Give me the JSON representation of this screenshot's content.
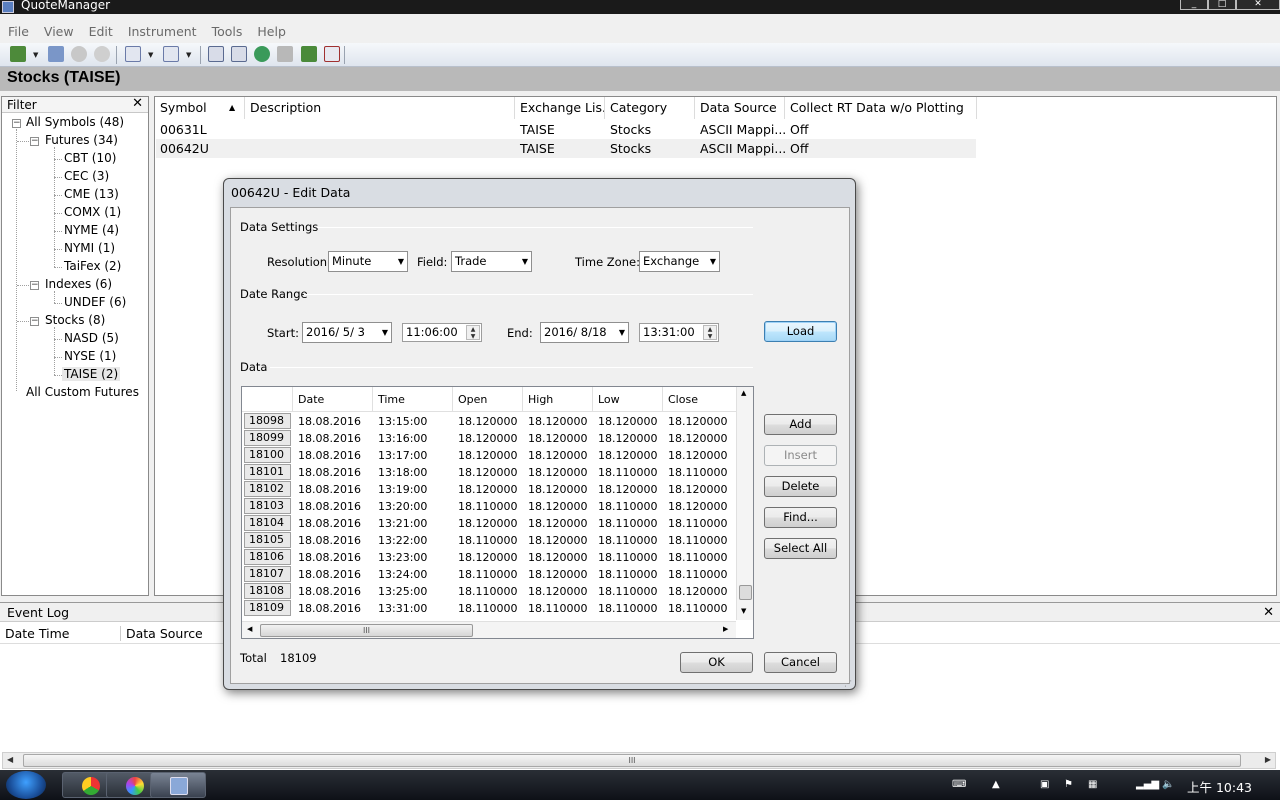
{
  "app": {
    "title": "QuoteManager"
  },
  "menu": [
    "File",
    "View",
    "Edit",
    "Instrument",
    "Tools",
    "Help"
  ],
  "toolbar_icons": [
    "add-instrument-icon",
    "add-symbol-icon",
    "settings-icon",
    "disconnect-icon",
    "import-icon",
    "export-icon",
    "view-list-icon",
    "view-detail-icon",
    "chart-icon",
    "exchange-icon",
    "notebook-icon",
    "calendar-icon"
  ],
  "window_header": "Stocks (TAISE)",
  "filter": {
    "title": "Filter",
    "close": "✕",
    "tree": [
      {
        "label": "All Symbols (48)",
        "level": 0,
        "box": "−"
      },
      {
        "label": "Futures (34)",
        "level": 1,
        "box": "−"
      },
      {
        "label": "CBT (10)",
        "level": 2
      },
      {
        "label": "CEC (3)",
        "level": 2
      },
      {
        "label": "CME (13)",
        "level": 2
      },
      {
        "label": "COMX (1)",
        "level": 2
      },
      {
        "label": "NYME (4)",
        "level": 2
      },
      {
        "label": "NYMI (1)",
        "level": 2
      },
      {
        "label": "TaiFex (2)",
        "level": 2
      },
      {
        "label": "Indexes (6)",
        "level": 1,
        "box": "−"
      },
      {
        "label": "UNDEF (6)",
        "level": 2
      },
      {
        "label": "Stocks (8)",
        "level": 1,
        "box": "−"
      },
      {
        "label": "NASD (5)",
        "level": 2
      },
      {
        "label": "NYSE (1)",
        "level": 2
      },
      {
        "label": "TAISE (2)",
        "level": 2,
        "selected": true
      },
      {
        "label": "All Custom Futures",
        "level": 0
      }
    ]
  },
  "grid": {
    "columns": [
      "Symbol",
      "Description",
      "Exchange Lis...",
      "Category",
      "Data Source",
      "Collect RT Data w/o Plotting"
    ],
    "sort_indicator": "▲",
    "rows": [
      [
        "00631L",
        "",
        "TAISE",
        "Stocks",
        "ASCII Mappi...",
        "Off"
      ],
      [
        "00642U",
        "",
        "TAISE",
        "Stocks",
        "ASCII Mappi...",
        "Off"
      ]
    ]
  },
  "eventlog": {
    "title": "Event Log",
    "close": "✕",
    "columns": [
      "Date Time",
      "Data Source"
    ],
    "scroll_grip": "III"
  },
  "dialog": {
    "title": "00642U - Edit Data",
    "data_settings": "Data Settings",
    "resolution_label": "Resolution:",
    "resolution_value": "Minute",
    "field_label": "Field:",
    "field_value": "Trade",
    "timezone_label": "Time Zone:",
    "timezone_value": "Exchange",
    "date_range": "Date Range",
    "start_label": "Start:",
    "start_date": "2016/ 5/ 3",
    "start_time": "11:06:00",
    "end_label": "End:",
    "end_date": "2016/ 8/18",
    "end_time": "13:31:00",
    "load": "Load",
    "data_label": "Data",
    "table": {
      "columns": [
        "Date",
        "Time",
        "Open",
        "High",
        "Low",
        "Close"
      ],
      "rows": [
        [
          "18098",
          "18.08.2016",
          "13:15:00",
          "18.120000",
          "18.120000",
          "18.120000",
          "18.120000"
        ],
        [
          "18099",
          "18.08.2016",
          "13:16:00",
          "18.120000",
          "18.120000",
          "18.120000",
          "18.120000"
        ],
        [
          "18100",
          "18.08.2016",
          "13:17:00",
          "18.120000",
          "18.120000",
          "18.120000",
          "18.120000"
        ],
        [
          "18101",
          "18.08.2016",
          "13:18:00",
          "18.120000",
          "18.120000",
          "18.110000",
          "18.110000"
        ],
        [
          "18102",
          "18.08.2016",
          "13:19:00",
          "18.120000",
          "18.120000",
          "18.120000",
          "18.120000"
        ],
        [
          "18103",
          "18.08.2016",
          "13:20:00",
          "18.110000",
          "18.120000",
          "18.110000",
          "18.120000"
        ],
        [
          "18104",
          "18.08.2016",
          "13:21:00",
          "18.120000",
          "18.120000",
          "18.110000",
          "18.110000"
        ],
        [
          "18105",
          "18.08.2016",
          "13:22:00",
          "18.110000",
          "18.120000",
          "18.110000",
          "18.110000"
        ],
        [
          "18106",
          "18.08.2016",
          "13:23:00",
          "18.120000",
          "18.120000",
          "18.110000",
          "18.110000"
        ],
        [
          "18107",
          "18.08.2016",
          "13:24:00",
          "18.110000",
          "18.120000",
          "18.110000",
          "18.110000"
        ],
        [
          "18108",
          "18.08.2016",
          "13:25:00",
          "18.110000",
          "18.120000",
          "18.110000",
          "18.120000"
        ],
        [
          "18109",
          "18.08.2016",
          "13:31:00",
          "18.110000",
          "18.110000",
          "18.110000",
          "18.110000"
        ]
      ]
    },
    "buttons": {
      "add": "Add",
      "insert": "Insert",
      "delete": "Delete",
      "find": "Find...",
      "select_all": "Select All",
      "ok": "OK",
      "cancel": "Cancel"
    },
    "total_label": "Total",
    "total_value": "18109",
    "scroll_grip": "III"
  },
  "taskbar": {
    "clock": "上午 10:43"
  }
}
